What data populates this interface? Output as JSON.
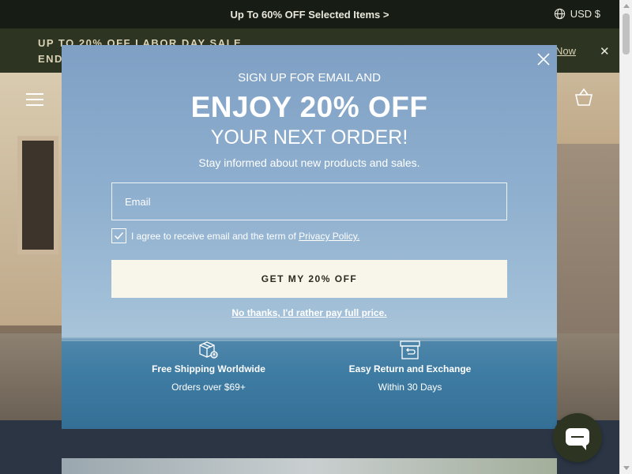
{
  "topbar": {
    "promo": "Up To 60% OFF Selected Items >",
    "currency": "USD $",
    "globe_icon": "globe-icon"
  },
  "banner": {
    "line1": "UP TO 20% OFF LABOR DAY SALE",
    "line2": "END",
    "link": "Now",
    "close_icon": "close-icon"
  },
  "header": {
    "menu_icon": "hamburger-menu-icon",
    "cart_icon": "shopping-basket-icon"
  },
  "modal": {
    "signup": "SIGN UP FOR EMAIL AND",
    "headline": "ENJOY 20% OFF",
    "subheadline": "YOUR NEXT ORDER!",
    "tagline": "Stay informed about new products and sales.",
    "email_placeholder": "Email",
    "agree_text": "I agree to receive email and the term of",
    "policy_link": "Privacy Policy.",
    "checkbox_checked": true,
    "cta": "GET MY 20% OFF",
    "decline": "No thanks, I'd rather pay full price.",
    "features": [
      {
        "icon": "package-location-icon",
        "title": "Free Shipping Worldwide",
        "subtitle": "Orders over $69+"
      },
      {
        "icon": "return-box-icon",
        "title": "Easy Return and Exchange",
        "subtitle": "Within 30 Days"
      }
    ]
  },
  "chat": {
    "icon": "chat-bubble-icon"
  },
  "colors": {
    "topbar_bg": "#171c15",
    "banner_bg": "#2d3522",
    "cta_bg": "#f8f6ea",
    "chat_bg": "#2d3522"
  }
}
